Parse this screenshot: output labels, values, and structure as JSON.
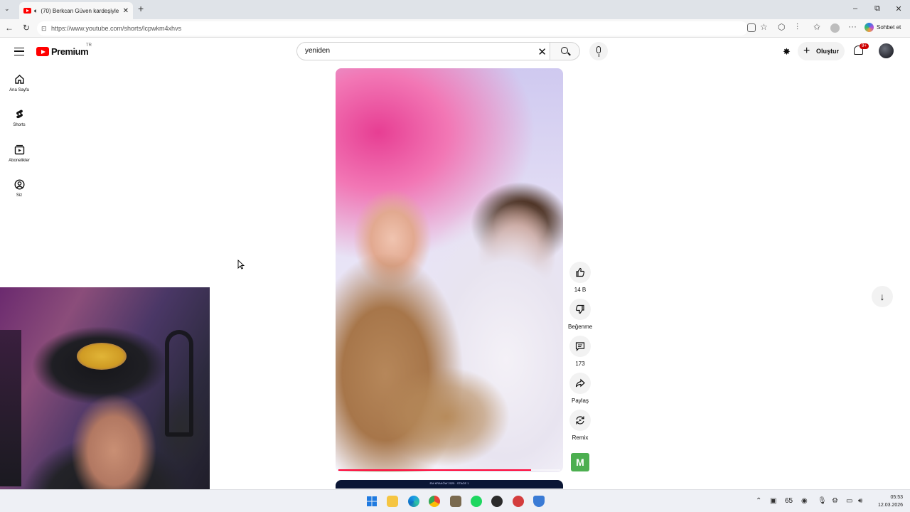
{
  "browser": {
    "tab_title": "(70) Berkcan Güven kardeşiyle",
    "url": "https://www.youtube.com/shorts/lcpwkm4xhvs",
    "copilot_label": "Sohbet et"
  },
  "youtube": {
    "logo_text": "Premium",
    "region": "TR",
    "search_value": "yeniden",
    "create_label": "Oluştur",
    "notification_badge": "9+"
  },
  "sidebar": {
    "items": [
      {
        "label": "Ana Sayfa",
        "icon": "home-icon"
      },
      {
        "label": "Shorts",
        "icon": "shorts-icon"
      },
      {
        "label": "Abonelikler",
        "icon": "subscriptions-icon"
      },
      {
        "label": "Siz",
        "icon": "you-icon"
      }
    ]
  },
  "video": {
    "progress": 0.87,
    "next_video_caption": "EM KRAKÓW 2025 · STAGE 1"
  },
  "actions": {
    "like_count": "14 B",
    "dislike_label": "Beğenme",
    "comment_count": "173",
    "share_label": "Paylaş",
    "remix_label": "Remix",
    "channel_initial": "M"
  },
  "taskbar": {
    "time": "05:53",
    "date": "12.03.2026",
    "tray_value": "65"
  },
  "colors": {
    "yt_red": "#ff0000",
    "progress_red": "#ff0033",
    "badge_red": "#cc0000",
    "channel_green": "#4caf50"
  }
}
